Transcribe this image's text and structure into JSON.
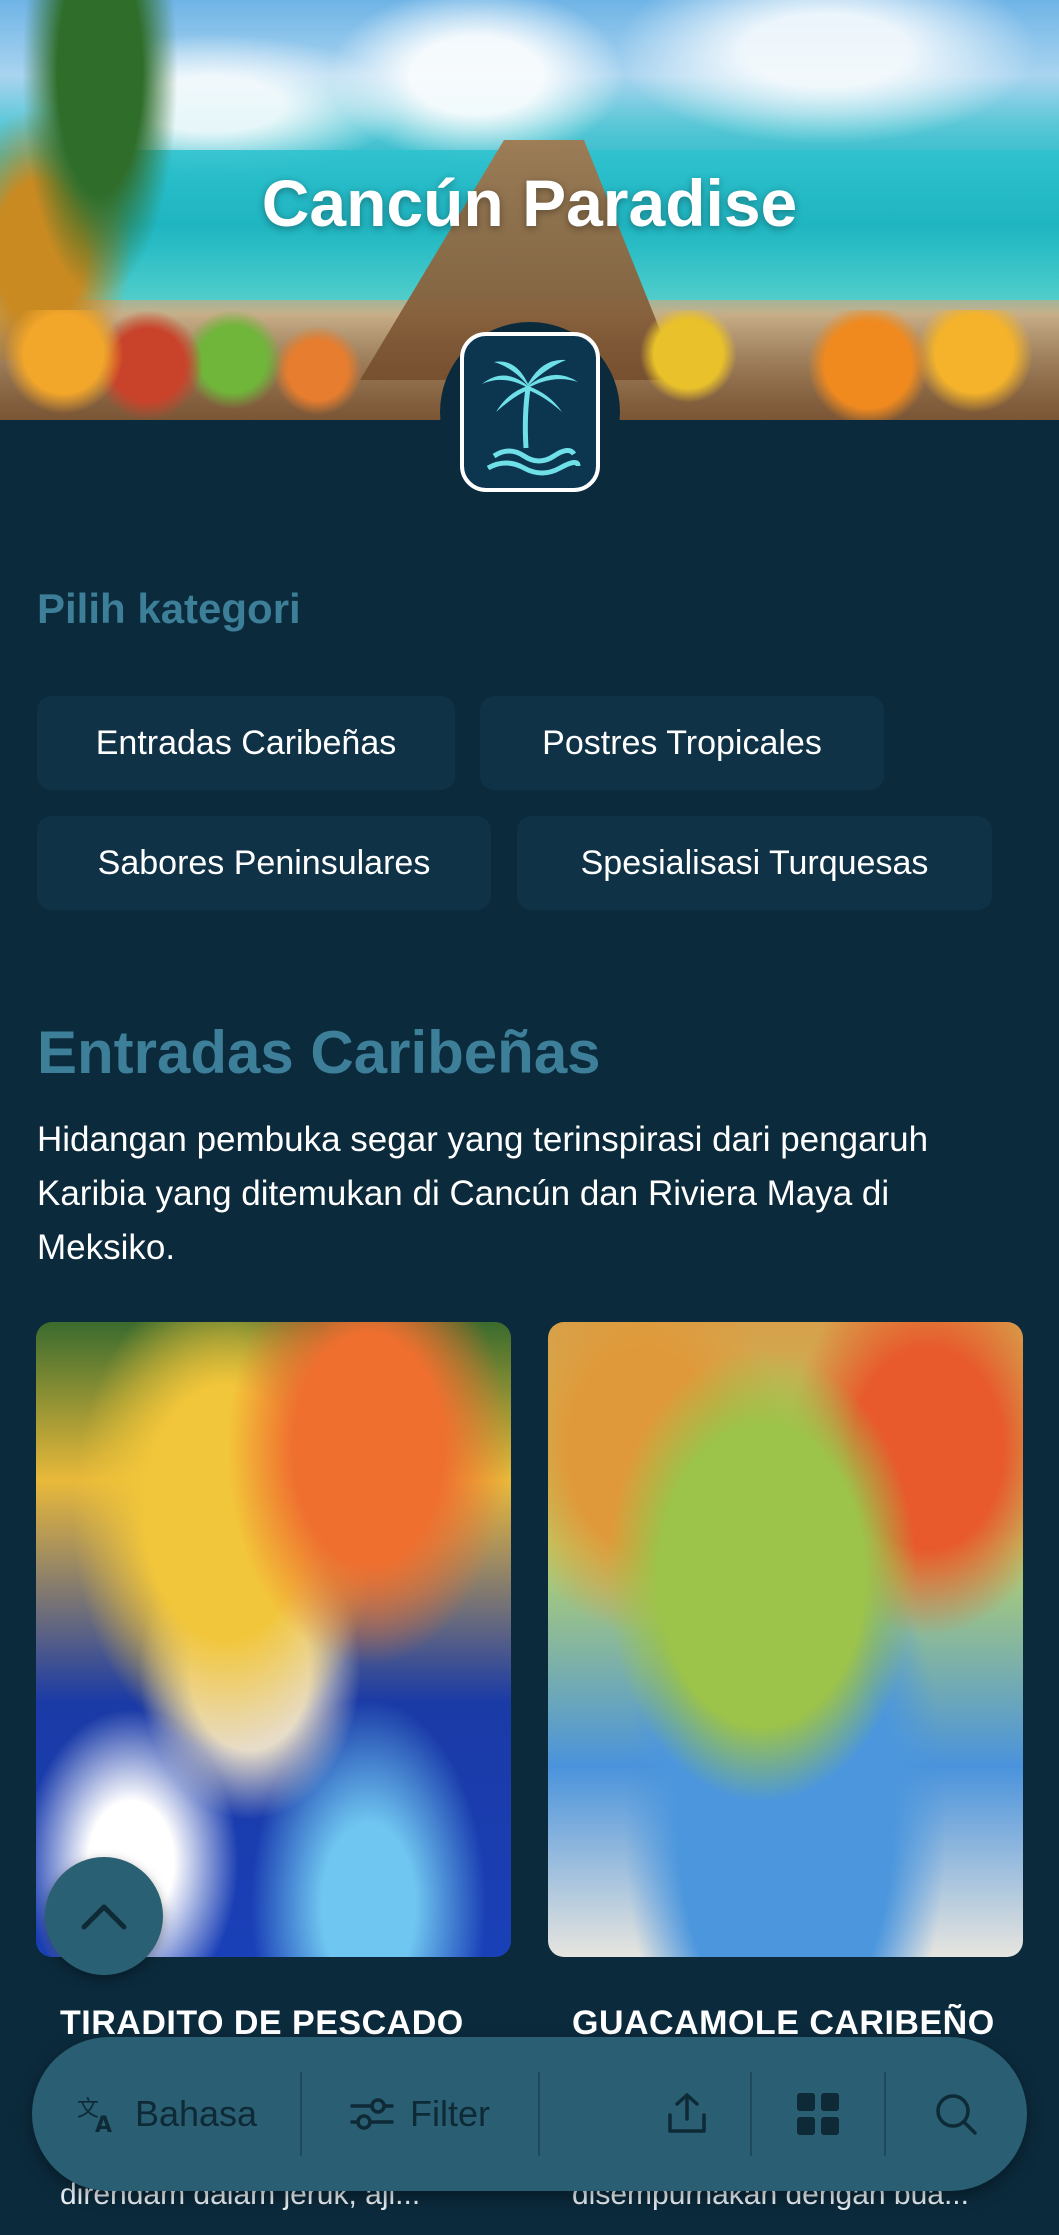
{
  "hero": {
    "title": "Cancún Paradise"
  },
  "categories": {
    "heading": "Pilih kategori",
    "items": [
      {
        "label": "Entradas Caribeñas"
      },
      {
        "label": "Postres Tropicales"
      },
      {
        "label": "Sabores Peninsulares"
      },
      {
        "label": "Spesialisasi Turquesas"
      }
    ]
  },
  "section": {
    "title": "Entradas Caribeñas",
    "description": "Hidangan pembuka segar yang terinspirasi dari pengaruh Karibia yang ditemukan di Cancún dan Riviera Maya di Meksiko."
  },
  "dishes": [
    {
      "name": "TIRADITO DE PESCADO",
      "desc": "direndam dalam jeruk, aji..."
    },
    {
      "name": "GUACAMOLE CARIBEÑO",
      "desc": "disempurnakan dengan bua..."
    }
  ],
  "bottom_bar": {
    "language_label": "Bahasa",
    "filter_label": "Filter"
  },
  "icons": {
    "language": "translate-icon",
    "filter": "sliders-icon",
    "share": "share-icon",
    "grid": "grid-icon",
    "search": "search-icon",
    "scroll_top": "chevron-up-icon",
    "logo": "palm-tree-logo"
  },
  "colors": {
    "background": "#0b2a3c",
    "accent": "#3d7f98",
    "chip": "#0f3246",
    "bar": "#2a5e72"
  }
}
